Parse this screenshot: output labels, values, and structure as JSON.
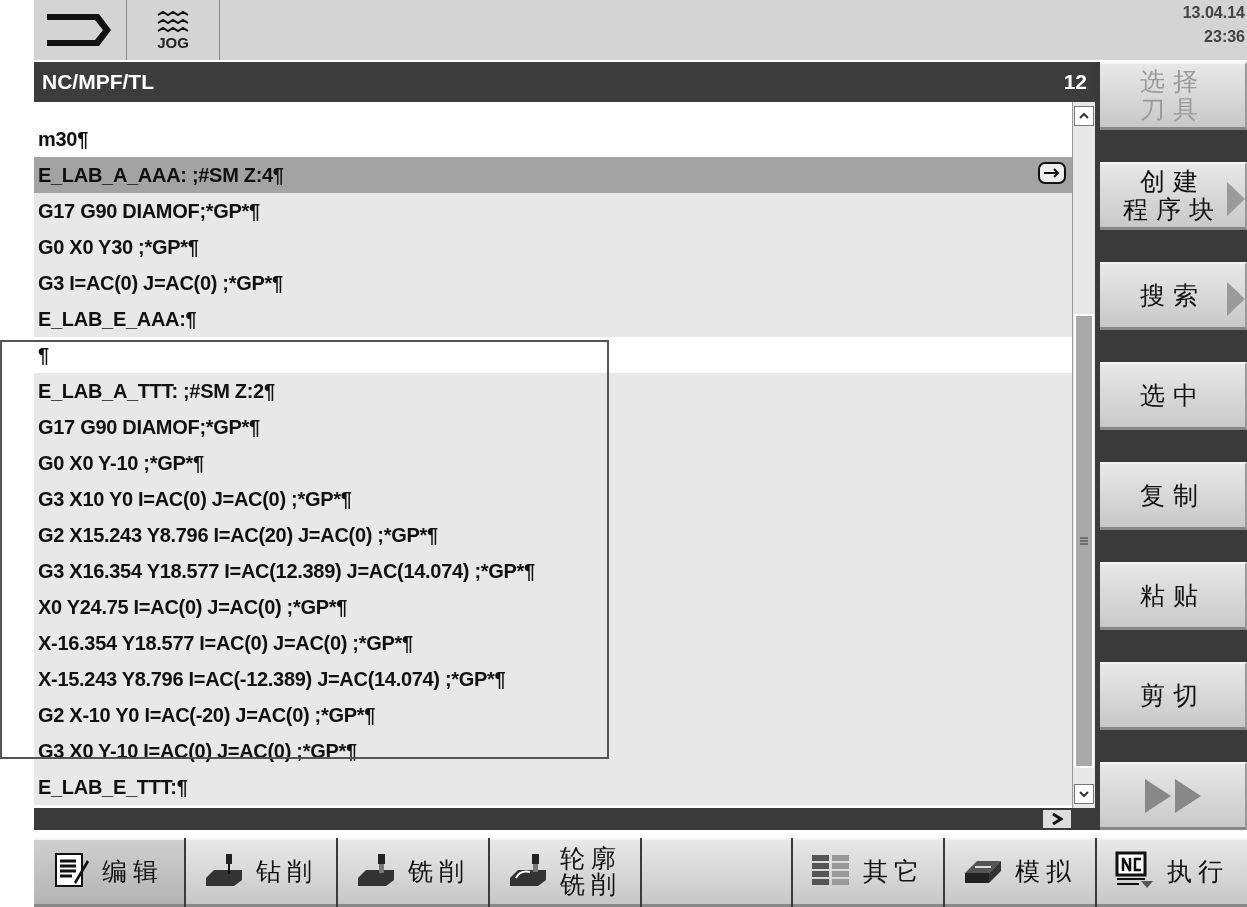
{
  "top_bar": {
    "mode": "JOG",
    "date": "13.04.14",
    "time": "23:36"
  },
  "header": {
    "path": "NC/MPF/TL",
    "line_count": "12"
  },
  "lines": [
    {
      "text": "m30¶",
      "kind": "plain"
    },
    {
      "text": "E_LAB_A_AAA: ;#SM Z:4¶",
      "kind": "cursor"
    },
    {
      "text": "G17 G90 DIAMOF;*GP*¶",
      "kind": "block"
    },
    {
      "text": "G0 X0 Y30 ;*GP*¶",
      "kind": "block"
    },
    {
      "text": "G3 I=AC(0) J=AC(0) ;*GP*¶",
      "kind": "block"
    },
    {
      "text": "E_LAB_E_AAA:¶",
      "kind": "block"
    },
    {
      "text": "¶",
      "kind": "plain"
    },
    {
      "text": "E_LAB_A_TTT: ;#SM Z:2¶",
      "kind": "block"
    },
    {
      "text": "G17 G90 DIAMOF;*GP*¶",
      "kind": "block"
    },
    {
      "text": "G0 X0 Y-10 ;*GP*¶",
      "kind": "block"
    },
    {
      "text": "G3 X10 Y0 I=AC(0) J=AC(0) ;*GP*¶",
      "kind": "block"
    },
    {
      "text": "G2 X15.243 Y8.796 I=AC(20) J=AC(0) ;*GP*¶",
      "kind": "block"
    },
    {
      "text": "G3 X16.354 Y18.577 I=AC(12.389) J=AC(14.074) ;*GP*¶",
      "kind": "block"
    },
    {
      "text": "X0 Y24.75 I=AC(0) J=AC(0) ;*GP*¶",
      "kind": "block"
    },
    {
      "text": "X-16.354 Y18.577 I=AC(0) J=AC(0) ;*GP*¶",
      "kind": "block"
    },
    {
      "text": "X-15.243 Y8.796 I=AC(-12.389) J=AC(14.074) ;*GP*¶",
      "kind": "block"
    },
    {
      "text": "G2 X-10 Y0 I=AC(-20) J=AC(0) ;*GP*¶",
      "kind": "block"
    },
    {
      "text": "G3 X0 Y-10 I=AC(0) J=AC(0) ;*GP*¶",
      "kind": "block"
    },
    {
      "text": "E_LAB_E_TTT:¶",
      "kind": "block"
    }
  ],
  "softkeys_right": [
    {
      "kind": "text",
      "label_lines": [
        "选择",
        "刀具"
      ],
      "disabled": true,
      "arrow": false
    },
    {
      "kind": "text",
      "label_lines": [
        "创建",
        "程序块"
      ],
      "disabled": false,
      "arrow": true
    },
    {
      "kind": "text",
      "label_lines": [
        "搜索"
      ],
      "disabled": false,
      "arrow": true
    },
    {
      "kind": "text",
      "label_lines": [
        "选中"
      ],
      "disabled": false,
      "arrow": false
    },
    {
      "kind": "text",
      "label_lines": [
        "复制"
      ],
      "disabled": false,
      "arrow": false
    },
    {
      "kind": "text",
      "label_lines": [
        "粘贴"
      ],
      "disabled": false,
      "arrow": false
    },
    {
      "kind": "text",
      "label_lines": [
        "剪切"
      ],
      "disabled": false,
      "arrow": false
    },
    {
      "kind": "more"
    }
  ],
  "softkeys_bottom": [
    {
      "label_lines": [
        "编辑"
      ],
      "kind": "edit",
      "selected": true
    },
    {
      "label_lines": [
        "钻削"
      ],
      "kind": "drill",
      "selected": false
    },
    {
      "label_lines": [
        "铣削"
      ],
      "kind": "mill",
      "selected": false
    },
    {
      "label_lines": [
        "轮廓",
        "铣削"
      ],
      "kind": "contour",
      "selected": false
    },
    {
      "kind": "blank",
      "selected": false
    },
    {
      "label_lines": [
        "其它"
      ],
      "kind": "grid",
      "selected": false
    },
    {
      "label_lines": [
        "模拟"
      ],
      "kind": "sim",
      "selected": false
    },
    {
      "label_lines": [
        "执行"
      ],
      "kind": "nc",
      "selected": false
    }
  ]
}
